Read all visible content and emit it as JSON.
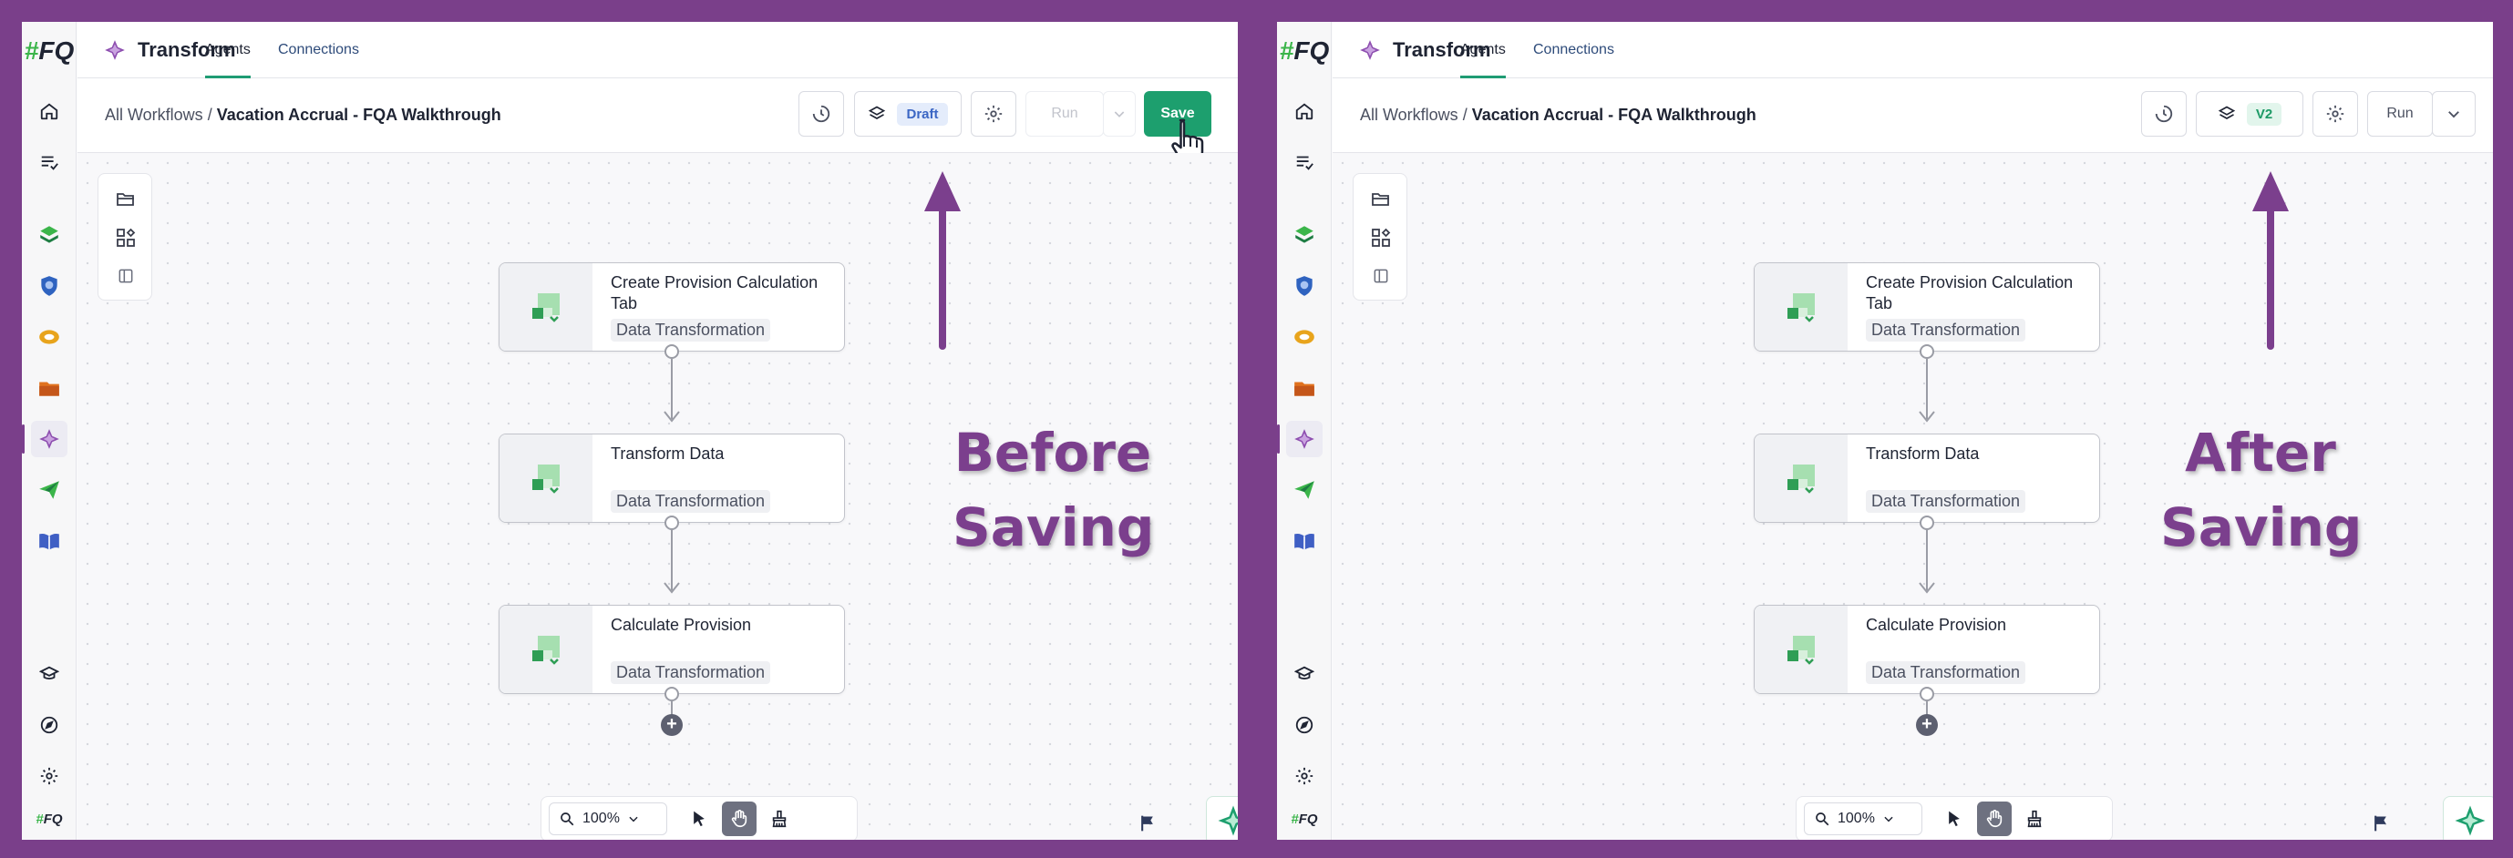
{
  "colors": {
    "frame": "#7a3f8a",
    "accent": "#1d9f6e",
    "annotation": "#7b3f8d"
  },
  "panels": [
    {
      "id": "before",
      "rail": {
        "logo": "#FQ",
        "mini_logo": "#FQ",
        "icons": [
          "home-icon",
          "tasks-icon",
          "stack-app-icon",
          "shield-app-icon",
          "link-app-icon",
          "folder-app-icon",
          "transform-app-icon",
          "send-app-icon",
          "book-app-icon",
          "learn-icon",
          "compass-icon",
          "settings-icon"
        ]
      },
      "topnav": {
        "brand": "Transform",
        "tabs": [
          "Agents",
          "Connections"
        ]
      },
      "breadcrumb": {
        "parent": "All Workflows",
        "separator": " / ",
        "current": "Vacation Accrual - FQA Walkthrough"
      },
      "toolbar": {
        "version_label": "Draft",
        "run_label": "Run",
        "save_label": "Save"
      },
      "nodes": [
        {
          "title": "Create Provision Calculation Tab",
          "tag": "Data Transformation"
        },
        {
          "title": "Transform Data",
          "tag": "Data Transformation"
        },
        {
          "title": "Calculate Provision",
          "tag": "Data Transformation"
        }
      ],
      "zoom": "100%",
      "annotation": {
        "line1": "Before",
        "line2": "Saving"
      }
    },
    {
      "id": "after",
      "rail": {
        "logo": "#FQ",
        "mini_logo": "#FQ",
        "icons": [
          "home-icon",
          "tasks-icon",
          "stack-app-icon",
          "shield-app-icon",
          "link-app-icon",
          "folder-app-icon",
          "transform-app-icon",
          "send-app-icon",
          "book-app-icon",
          "learn-icon",
          "compass-icon",
          "settings-icon"
        ]
      },
      "topnav": {
        "brand": "Transform",
        "tabs": [
          "Agents",
          "Connections"
        ]
      },
      "breadcrumb": {
        "parent": "All Workflows",
        "separator": " / ",
        "current": "Vacation Accrual - FQA Walkthrough"
      },
      "toolbar": {
        "version_label": "V2",
        "run_label": "Run"
      },
      "nodes": [
        {
          "title": "Create Provision Calculation Tab",
          "tag": "Data Transformation"
        },
        {
          "title": "Transform Data",
          "tag": "Data Transformation"
        },
        {
          "title": "Calculate Provision",
          "tag": "Data Transformation"
        }
      ],
      "zoom": "100%",
      "annotation": {
        "line1": "After",
        "line2": "Saving"
      }
    }
  ]
}
